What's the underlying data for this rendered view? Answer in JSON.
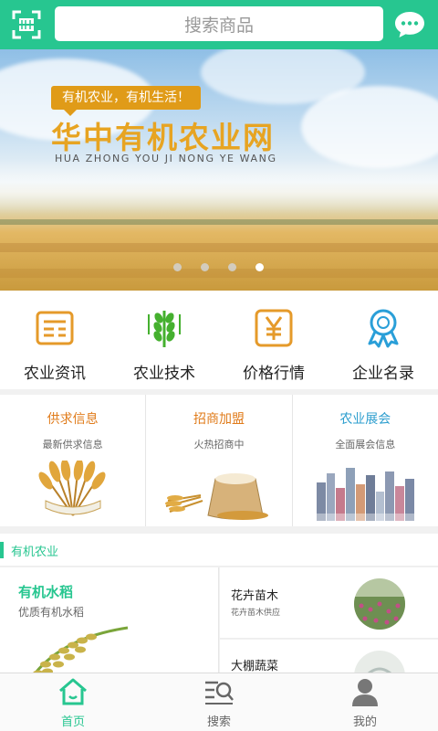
{
  "header": {
    "search_placeholder": "搜索商品",
    "scan_icon": "scan-icon",
    "chat_icon": "chat-bubble-icon",
    "accent_color": "#27c690"
  },
  "banner": {
    "slogan": "有机农业，有机生活！",
    "title": "华中有机农业网",
    "subtitle": "HUA ZHONG YOU JI NONG YE WANG",
    "slide_count": 4,
    "active_slide": 4
  },
  "quick_nav": [
    {
      "label": "农业资讯",
      "icon": "news-icon"
    },
    {
      "label": "农业技术",
      "icon": "wheat-icon"
    },
    {
      "label": "价格行情",
      "icon": "yuan-icon"
    },
    {
      "label": "企业名录",
      "icon": "award-ribbon-icon"
    }
  ],
  "cards": [
    {
      "title": "供求信息",
      "subtitle": "最新供求信息",
      "title_color": "#e07b1a"
    },
    {
      "title": "招商加盟",
      "subtitle": "火热招商中",
      "title_color": "#e07b1a"
    },
    {
      "title": "农业展会",
      "subtitle": "全面展会信息",
      "title_color": "#2f9fcf"
    }
  ],
  "section": {
    "title": "有机农业",
    "feature": {
      "title": "有机水稻",
      "subtitle": "优质有机水稻"
    },
    "items": [
      {
        "title": "花卉苗木",
        "subtitle": "花卉苗木供应"
      },
      {
        "title": "大棚蔬菜",
        "subtitle": ""
      }
    ]
  },
  "bottom_nav": [
    {
      "label": "首页",
      "icon": "home-icon",
      "active": true
    },
    {
      "label": "搜索",
      "icon": "search-list-icon",
      "active": false
    },
    {
      "label": "我的",
      "icon": "user-icon",
      "active": false
    }
  ]
}
